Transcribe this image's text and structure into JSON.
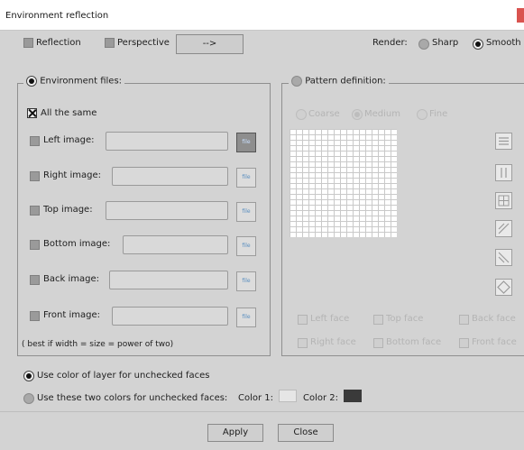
{
  "window": {
    "title": "Environment reflection"
  },
  "top_options": {
    "reflection_label": "Reflection",
    "perspective_label": "Perspective",
    "arrow_button_label": "-->",
    "render_label": "Render:",
    "sharp_label": "Sharp",
    "smooth_label": "Smooth"
  },
  "environment": {
    "group_label": "Environment files:",
    "all_same_label": "All the same",
    "images": [
      {
        "label": "Left image:"
      },
      {
        "label": "Right image:"
      },
      {
        "label": "Top image:"
      },
      {
        "label": "Bottom image:"
      },
      {
        "label": "Back image:"
      },
      {
        "label": "Front image:"
      }
    ],
    "browse_icon_text": "file",
    "hint": "( best if width = size = power of two)"
  },
  "pattern": {
    "group_label": "Pattern definition:",
    "density": [
      "Coarse",
      "Medium",
      "Fine"
    ],
    "faces": [
      "Left face",
      "Top face",
      "Back face",
      "Right face",
      "Bottom face",
      "Front face"
    ],
    "pattern_buttons": [
      "horizontal-lines-icon",
      "vertical-lines-icon",
      "grid-icon",
      "diagonal-right-icon",
      "diagonal-left-icon",
      "diamond-icon"
    ]
  },
  "bottom": {
    "use_layer_color_label": "Use color of layer for unchecked faces",
    "use_two_colors_label": "Use these two colors for unchecked faces:",
    "color1_label": "Color 1:",
    "color2_label": "Color 2:",
    "color1": "#e6e6e6",
    "color2": "#3a3a3a"
  },
  "buttons": {
    "apply": "Apply",
    "close": "Close"
  }
}
